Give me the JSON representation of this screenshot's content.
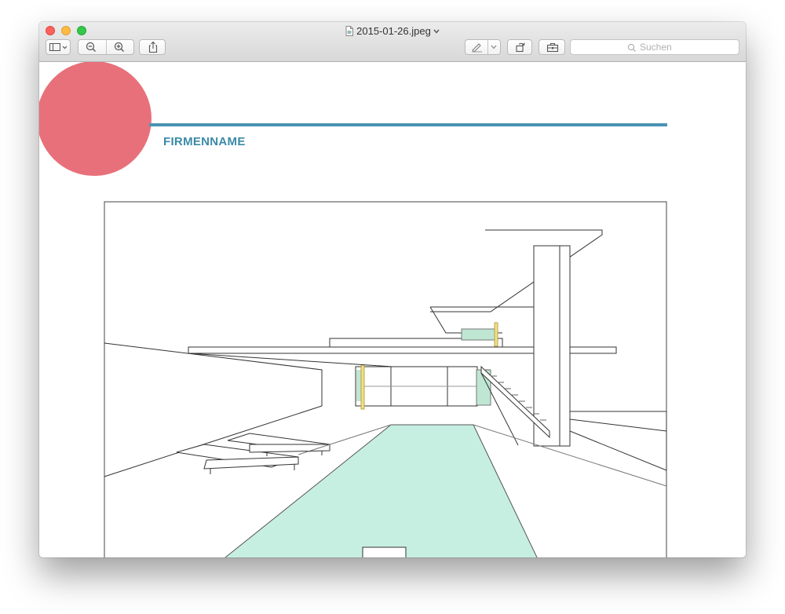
{
  "window": {
    "filename": "2015-01-26.jpeg"
  },
  "toolbar": {
    "search_placeholder": "Suchen",
    "icons": [
      "sidebar-icon",
      "chevron-down-icon",
      "zoom-out-icon",
      "zoom-in-icon",
      "share-icon",
      "markup-pen-icon",
      "rotate-icon",
      "toolbox-icon",
      "search-icon"
    ]
  },
  "document": {
    "company_name": "FIRMENNAME"
  },
  "colors": {
    "accent_circle": "#e8707a",
    "header_line": "#4a93b3",
    "company_text": "#3a8aa7",
    "pool_water": "#a9e6d4"
  }
}
